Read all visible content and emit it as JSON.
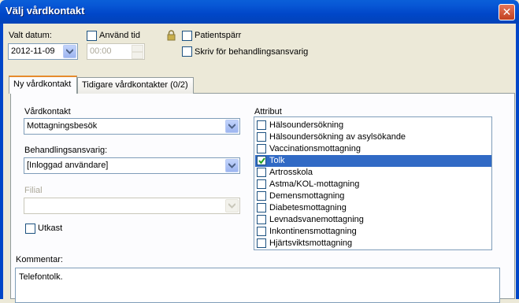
{
  "window": {
    "title": "Välj vårdkontakt",
    "close_glyph": "✕"
  },
  "top": {
    "date_label": "Valt datum:",
    "date_value": "2012-11-09",
    "use_time_label": "Använd tid",
    "use_time_checked": false,
    "time_value": "00:00",
    "patient_lock_label": "Patientspärr",
    "patient_lock_checked": false,
    "write_for_label": "Skriv för behandlingsansvarig",
    "write_for_checked": false
  },
  "tabs": [
    {
      "label": "Ny vårdkontakt",
      "active": true
    },
    {
      "label": "Tidigare vårdkontakter (0/2)",
      "active": false
    }
  ],
  "form": {
    "contact_label": "Vårdkontakt",
    "contact_value": "Mottagningsbesök",
    "responsible_label": "Behandlingsansvarig:",
    "responsible_value": "[Inloggad användare]",
    "branch_label": "Filial",
    "branch_value": "",
    "draft_label": "Utkast",
    "draft_checked": false
  },
  "attributes": {
    "label": "Attribut",
    "items": [
      {
        "label": "Hälsoundersökning",
        "checked": false,
        "selected": false
      },
      {
        "label": "Hälsoundersökning av asylsökande",
        "checked": false,
        "selected": false
      },
      {
        "label": "Vaccinationsmottagning",
        "checked": false,
        "selected": false
      },
      {
        "label": "Tolk",
        "checked": true,
        "selected": true
      },
      {
        "label": "Artrosskola",
        "checked": false,
        "selected": false
      },
      {
        "label": "Astma/KOL-mottagning",
        "checked": false,
        "selected": false
      },
      {
        "label": "Demensmottagning",
        "checked": false,
        "selected": false
      },
      {
        "label": "Diabetesmottagning",
        "checked": false,
        "selected": false
      },
      {
        "label": "Levnadsvanemottagning",
        "checked": false,
        "selected": false
      },
      {
        "label": "Inkontinensmottagning",
        "checked": false,
        "selected": false
      },
      {
        "label": "Hjärtsviktsmottagning",
        "checked": false,
        "selected": false
      }
    ]
  },
  "comment": {
    "label": "Kommentar:",
    "value": "Telefontolk."
  },
  "colors": {
    "title_bar": "#0046c8",
    "selection": "#316ac5",
    "tab_accent": "#e68b2c",
    "lock": "#b8a04a"
  }
}
